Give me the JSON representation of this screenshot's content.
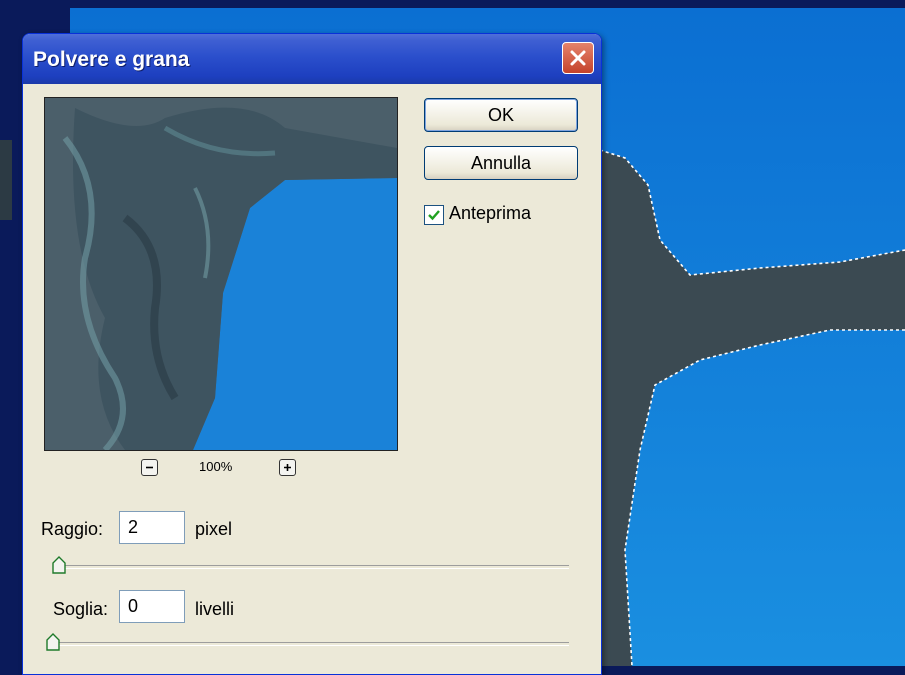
{
  "dialog": {
    "title": "Polvere e grana",
    "buttons": {
      "ok": "OK",
      "cancel": "Annulla"
    },
    "preview_checkbox": {
      "label": "Anteprima",
      "checked": true
    },
    "zoom": {
      "level": "100%"
    },
    "radius": {
      "label": "Raggio:",
      "value": "2",
      "unit": "pixel"
    },
    "threshold": {
      "label": "Soglia:",
      "value": "0",
      "unit": "livelli"
    }
  },
  "icons": {
    "close": "close-icon",
    "zoom_out": "zoom-out-icon",
    "zoom_in": "zoom-in-icon",
    "check": "checkmark-icon"
  },
  "colors": {
    "titlebar": "#2b4fcc",
    "dialog_bg": "#ece9d8",
    "sky": "#1d84d6",
    "close_button": "#c4432b"
  }
}
